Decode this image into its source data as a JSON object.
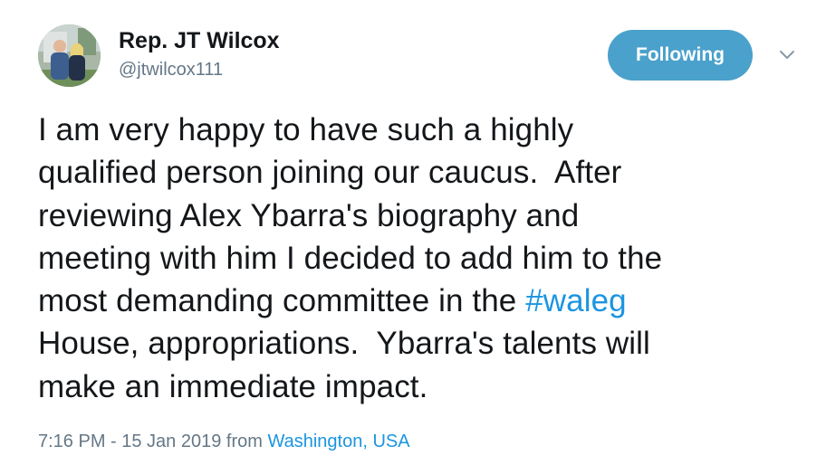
{
  "tweet": {
    "author": {
      "display_name": "Rep. JT Wilcox",
      "handle": "@jtwilcox111"
    },
    "follow_button_label": "Following",
    "caret_icon": "chevron-down-icon",
    "body": {
      "line1": "I am very happy to have such a highly",
      "line2": "qualified person joining our caucus.  After",
      "line3": "reviewing Alex Ybarra's biography and",
      "line4": "meeting with him I decided to add him to the",
      "line5_before": "most demanding committee in the ",
      "hashtag": "#waleg",
      "line6": "House, appropriations.  Ybarra's talents will",
      "line7": "make an immediate impact."
    },
    "timestamp": "7:16 PM - 15 Jan 2019",
    "from_label": "from",
    "location": "Washington, USA"
  },
  "colors": {
    "accent": "#1b95e0",
    "follow_button": "#4aa1cb",
    "secondary_text": "#657786",
    "primary_text": "#14171a"
  }
}
